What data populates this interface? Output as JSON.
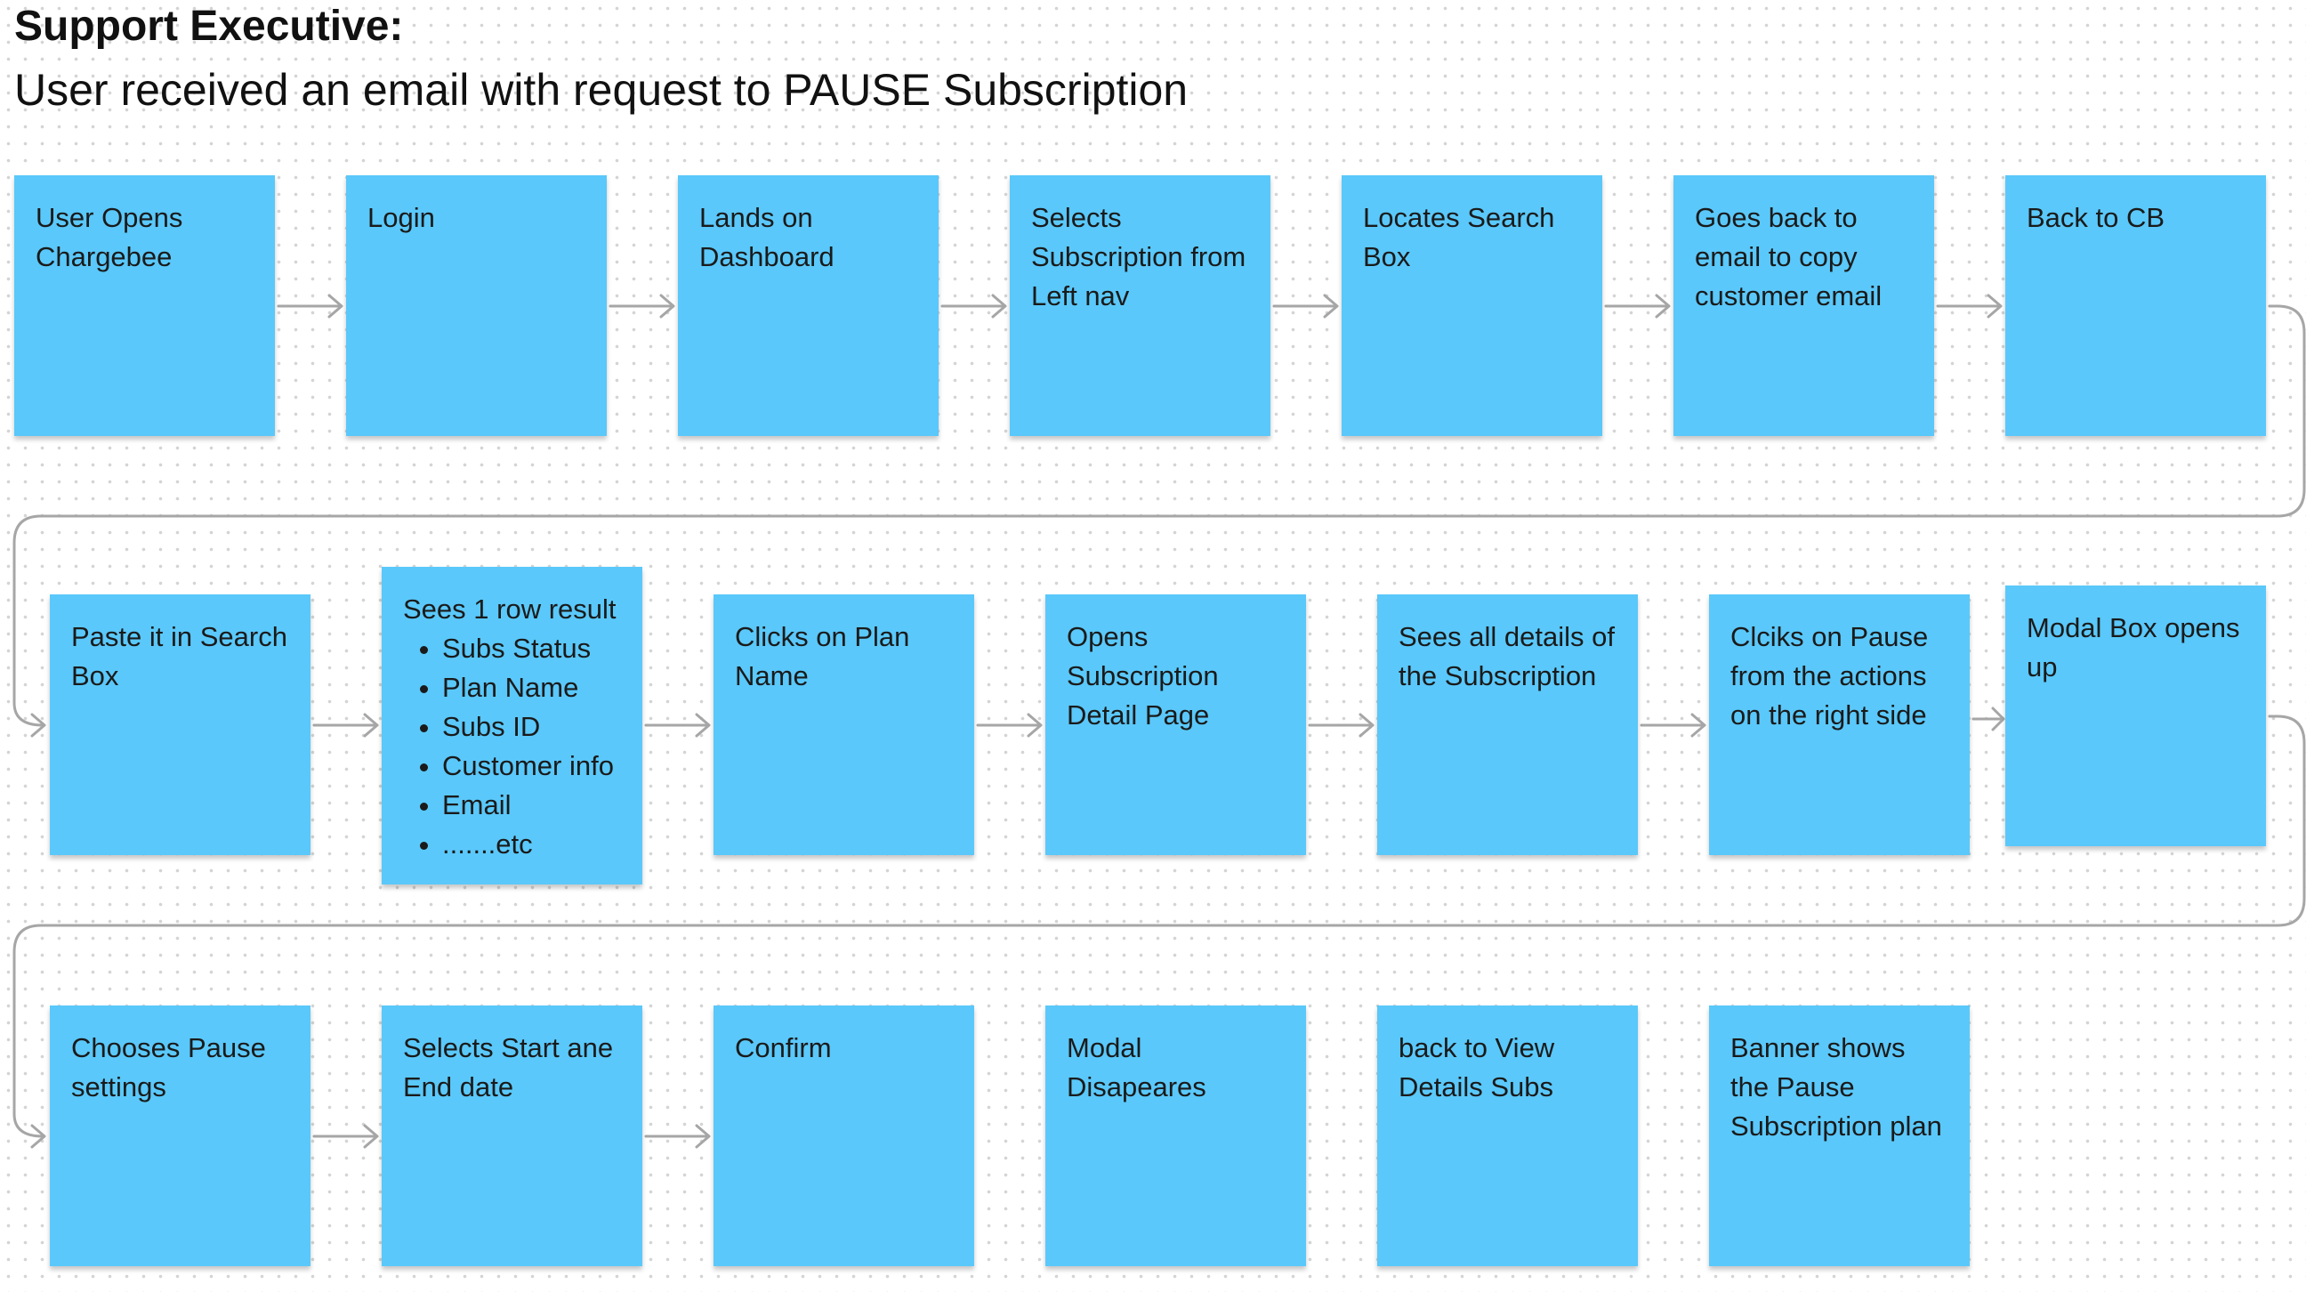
{
  "title": "Support Executive:",
  "subtitle": "User received an email with request to PAUSE Subscription",
  "colors": {
    "card": "#5ac8fa",
    "connector": "#a6a6a6"
  },
  "steps": [
    {
      "label": "User Opens Chargebee"
    },
    {
      "label": "Login"
    },
    {
      "label": "Lands on Dashboard"
    },
    {
      "label": "Selects Subscription from Left nav"
    },
    {
      "label": "Locates Search Box"
    },
    {
      "label": "Goes back to email to copy customer email"
    },
    {
      "label": "Back to CB"
    },
    {
      "label": "Paste it in Search Box"
    },
    {
      "label": "Sees 1 row result",
      "items": [
        "Subs Status",
        "Plan Name",
        "Subs ID",
        "Customer info",
        "Email",
        ".......etc"
      ]
    },
    {
      "label": "Clicks on Plan Name"
    },
    {
      "label": "Opens Subscription Detail Page"
    },
    {
      "label": "Sees all details of the Subscription"
    },
    {
      "label": "Clciks on Pause from the actions on the right side"
    },
    {
      "label": "Modal Box opens up"
    },
    {
      "label": "Chooses Pause settings"
    },
    {
      "label": "Selects Start ane End date"
    },
    {
      "label": "Confirm"
    },
    {
      "label": "Modal Disapeares"
    },
    {
      "label": "back to View Details Subs"
    },
    {
      "label": "Banner shows the Pause Subscription plan"
    }
  ]
}
